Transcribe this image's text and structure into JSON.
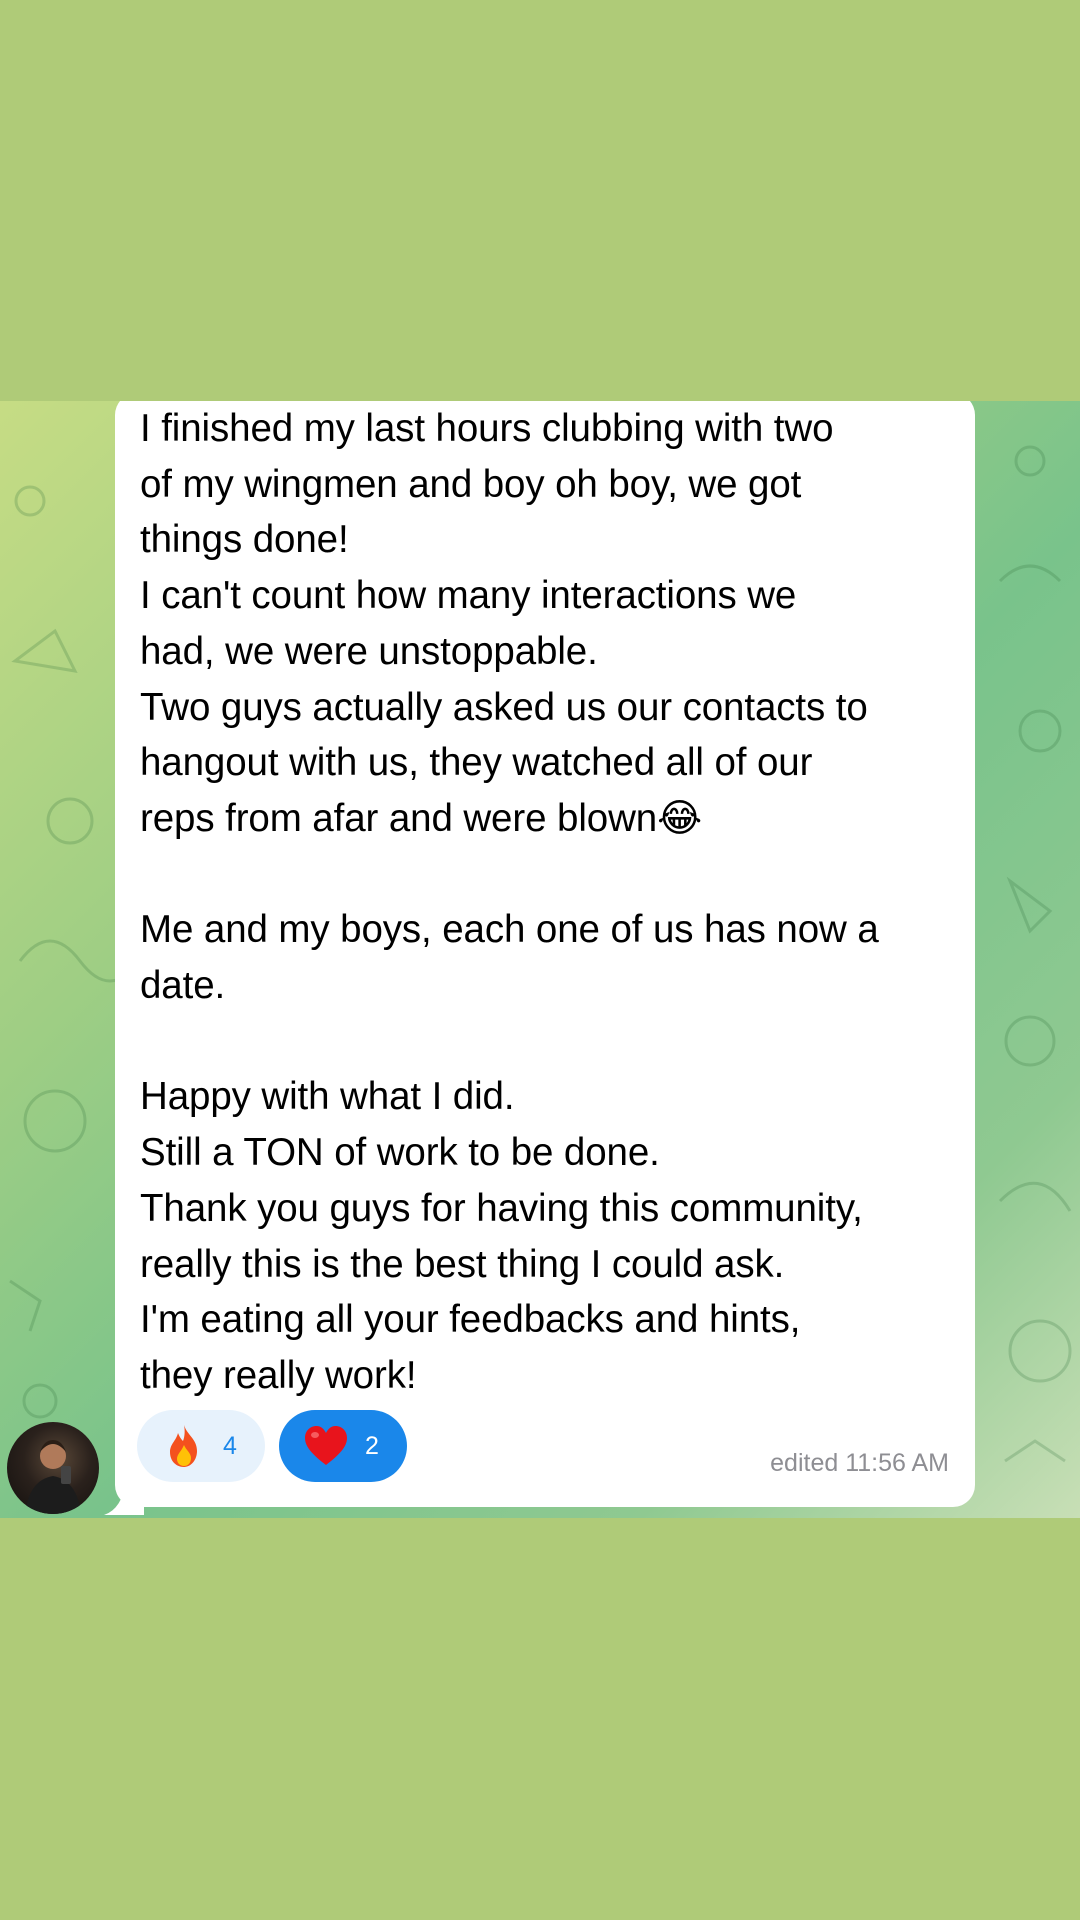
{
  "message": {
    "text": "I finished my last hours clubbing with two\nof my wingmen and boy oh boy, we got\nthings done!\nI can't count how many interactions we\nhad, we were unstoppable.\nTwo guys actually asked us our contacts to\nhangout with us, they watched all of our\nreps from afar and were blown😂\n\nMe and my boys, each one of us has now a\ndate.\n\nHappy with what I did.\nStill a TON of work to be done.\nThank you guys for having this community,\nreally this is the best thing I could ask.\nI'm eating all your feedbacks and hints,\nthey really work!",
    "meta": "edited 11:56 AM"
  },
  "reactions": [
    {
      "emoji": "fire-icon",
      "count": "4",
      "selected": false
    },
    {
      "emoji": "heart-icon",
      "count": "2",
      "selected": true
    }
  ],
  "colors": {
    "page_background": "#afcb78",
    "bubble": "#ffffff",
    "accent": "#1a87ea",
    "reaction_idle": "#e7f2fc",
    "meta_text": "#8e8e93"
  }
}
